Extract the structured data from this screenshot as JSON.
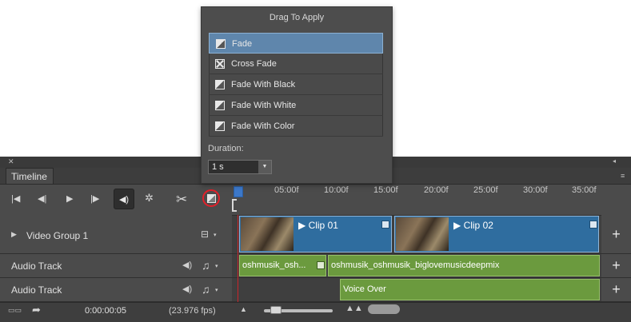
{
  "popup": {
    "title": "Drag To Apply",
    "items": [
      {
        "label": "Fade",
        "icon": "fade-icon",
        "selected": true
      },
      {
        "label": "Cross Fade",
        "icon": "cross-fade-icon",
        "selected": false
      },
      {
        "label": "Fade With Black",
        "icon": "fade-icon",
        "selected": false
      },
      {
        "label": "Fade With White",
        "icon": "fade-icon",
        "selected": false
      },
      {
        "label": "Fade With Color",
        "icon": "fade-icon",
        "selected": false
      }
    ],
    "duration_label": "Duration:",
    "duration_value": "1 s"
  },
  "panel": {
    "tab_label": "Timeline"
  },
  "ruler": {
    "ticks": [
      "05:00f",
      "10:00f",
      "15:00f",
      "20:00f",
      "25:00f",
      "30:00f",
      "35:00f"
    ]
  },
  "tracks": {
    "video_group": {
      "label": "Video Group 1"
    },
    "audio1": {
      "label": "Audio Track"
    },
    "audio2": {
      "label": "Audio Track"
    }
  },
  "clips": {
    "video": [
      {
        "name": "Clip 01"
      },
      {
        "name": "Clip 02"
      }
    ],
    "audio1": [
      {
        "name": "oshmusik_osh..."
      },
      {
        "name": "oshmusik_oshmusik_biglovemusicdeepmix"
      }
    ],
    "audio2": [
      {
        "name": "Voice Over"
      }
    ]
  },
  "status": {
    "timecode": "0:00:00:05",
    "fps": "(23.976 fps)"
  },
  "colors": {
    "video_clip": "#2f6d9f",
    "audio_clip": "#6b9a3e",
    "highlight_circle": "#e2202a",
    "playhead": "#3c78c9",
    "selected_item": "#5f86ac"
  }
}
